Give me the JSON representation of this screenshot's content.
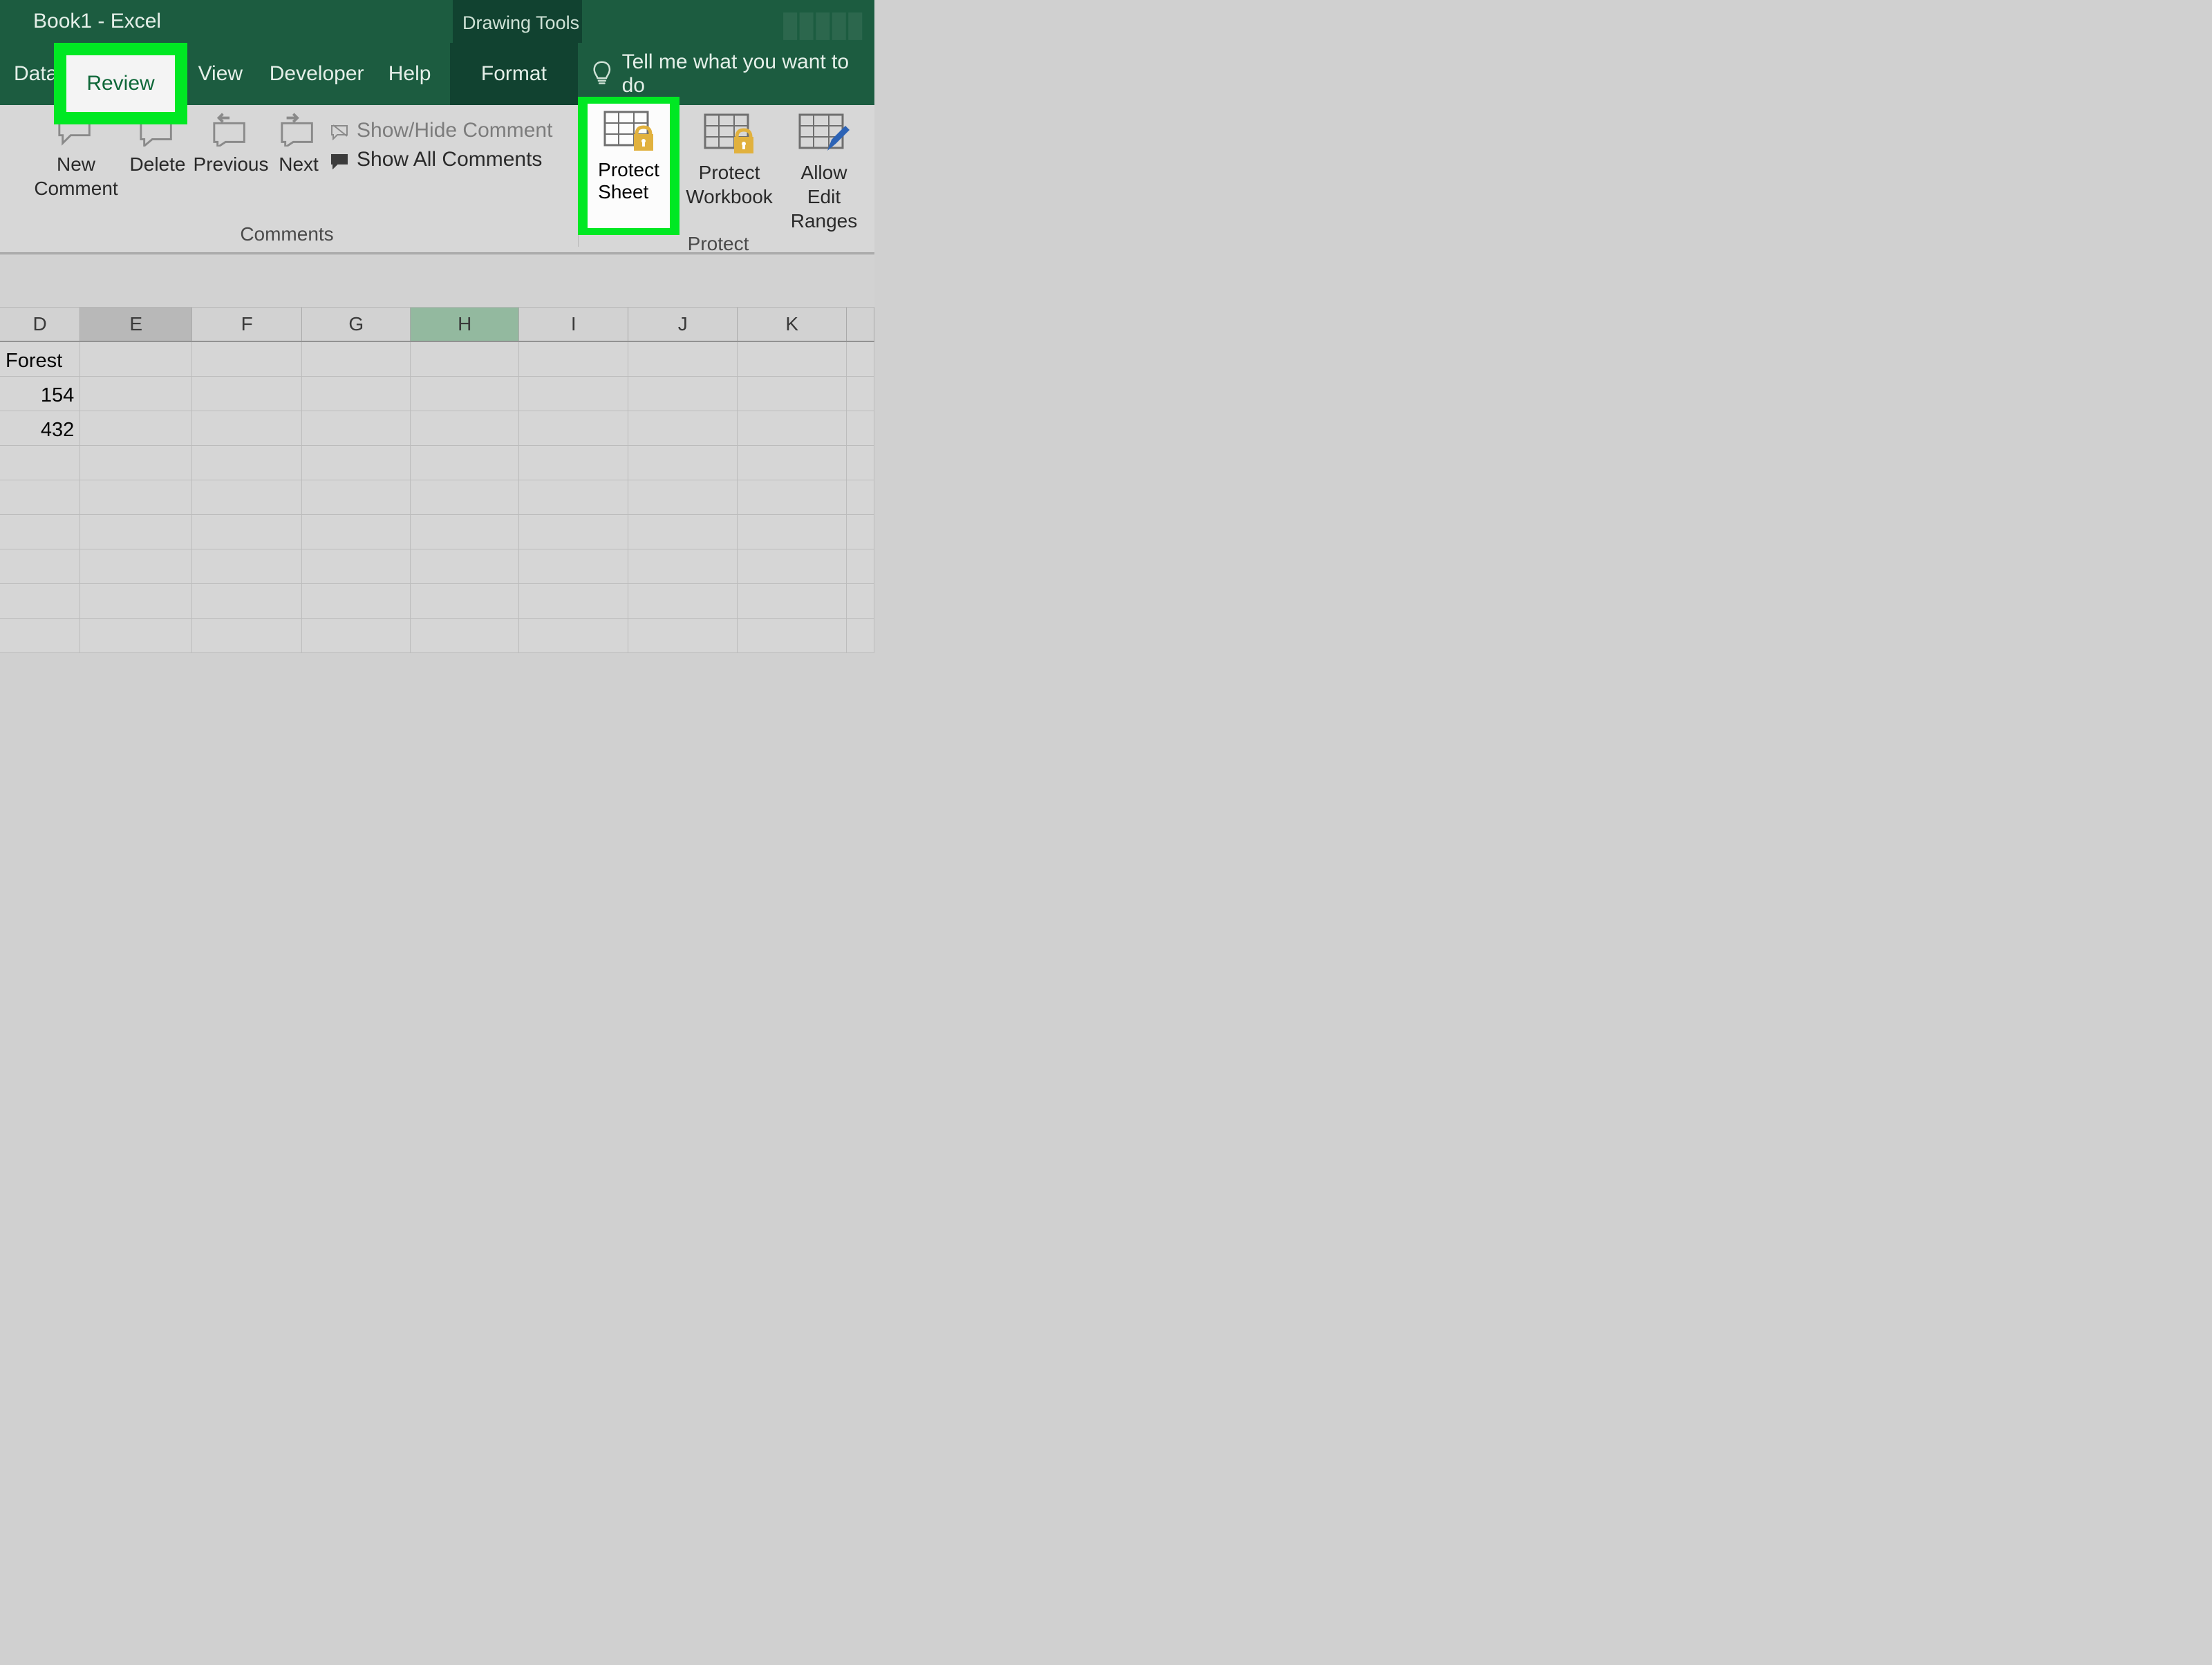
{
  "title": "Book1  -  Excel",
  "drawing_tools": "Drawing Tools",
  "tabs": {
    "data": "Data",
    "review": "Review",
    "view": "View",
    "developer": "Developer",
    "help": "Help",
    "format": "Format"
  },
  "tellme": "Tell me what you want to do",
  "ribbon": {
    "comments": {
      "new_line1": "New",
      "new_line2": "Comment",
      "delete": "Delete",
      "previous": "Previous",
      "next": "Next",
      "show_hide": "Show/Hide Comment",
      "show_all": "Show All Comments",
      "group_label": "Comments"
    },
    "protect": {
      "protect_sheet_line1": "Protect",
      "protect_sheet_line2": "Sheet",
      "protect_workbook_line1": "Protect",
      "protect_workbook_line2": "Workbook",
      "allow_edit_line1": "Allow Edit",
      "allow_edit_line2": "Ranges",
      "group_label": "Protect"
    }
  },
  "columns": [
    "D",
    "E",
    "F",
    "G",
    "H",
    "I",
    "J",
    "K"
  ],
  "cells": {
    "d1": "Forest",
    "d2": "154",
    "d3": "432"
  }
}
